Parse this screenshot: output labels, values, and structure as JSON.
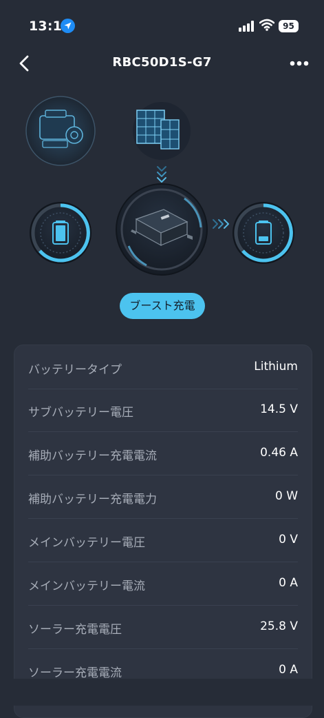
{
  "status_bar": {
    "time": "13:11",
    "battery": "95",
    "icons": [
      "location-arrow-icon",
      "cellular-signal-icon",
      "wifi-icon",
      "battery-icon"
    ]
  },
  "header": {
    "title": "RBC50D1S-G7",
    "back_icon": "chevron-left-icon",
    "menu_icon": "more-horizontal-icon"
  },
  "diagram": {
    "sources": [
      "engine-icon",
      "solar-panel-icon"
    ],
    "auxiliary_battery_icon": "battery-icon",
    "charger_icon": "charger-device-icon",
    "main_battery_icon": "battery-icon",
    "flow_arrows": [
      "arrow-down-icon",
      "arrow-right-icon"
    ]
  },
  "charge_mode": "ブースト充電",
  "info": [
    {
      "label": "バッテリータイプ",
      "value": "Lithium"
    },
    {
      "label": "サブバッテリー電圧",
      "value": "14.5 V"
    },
    {
      "label": "補助バッテリー充電電流",
      "value": "0.46 A"
    },
    {
      "label": "補助バッテリー充電電力",
      "value": "0 W"
    },
    {
      "label": "メインバッテリー電圧",
      "value": "0 V"
    },
    {
      "label": "メインバッテリー電流",
      "value": "0 A"
    },
    {
      "label": "ソーラー充電電圧",
      "value": "25.8 V"
    },
    {
      "label": "ソーラー充電電流",
      "value": "0 A"
    }
  ],
  "colors": {
    "background": "#262c37",
    "card": "#2e3441",
    "accent": "#4cc3ef",
    "label": "#a7adb8"
  }
}
